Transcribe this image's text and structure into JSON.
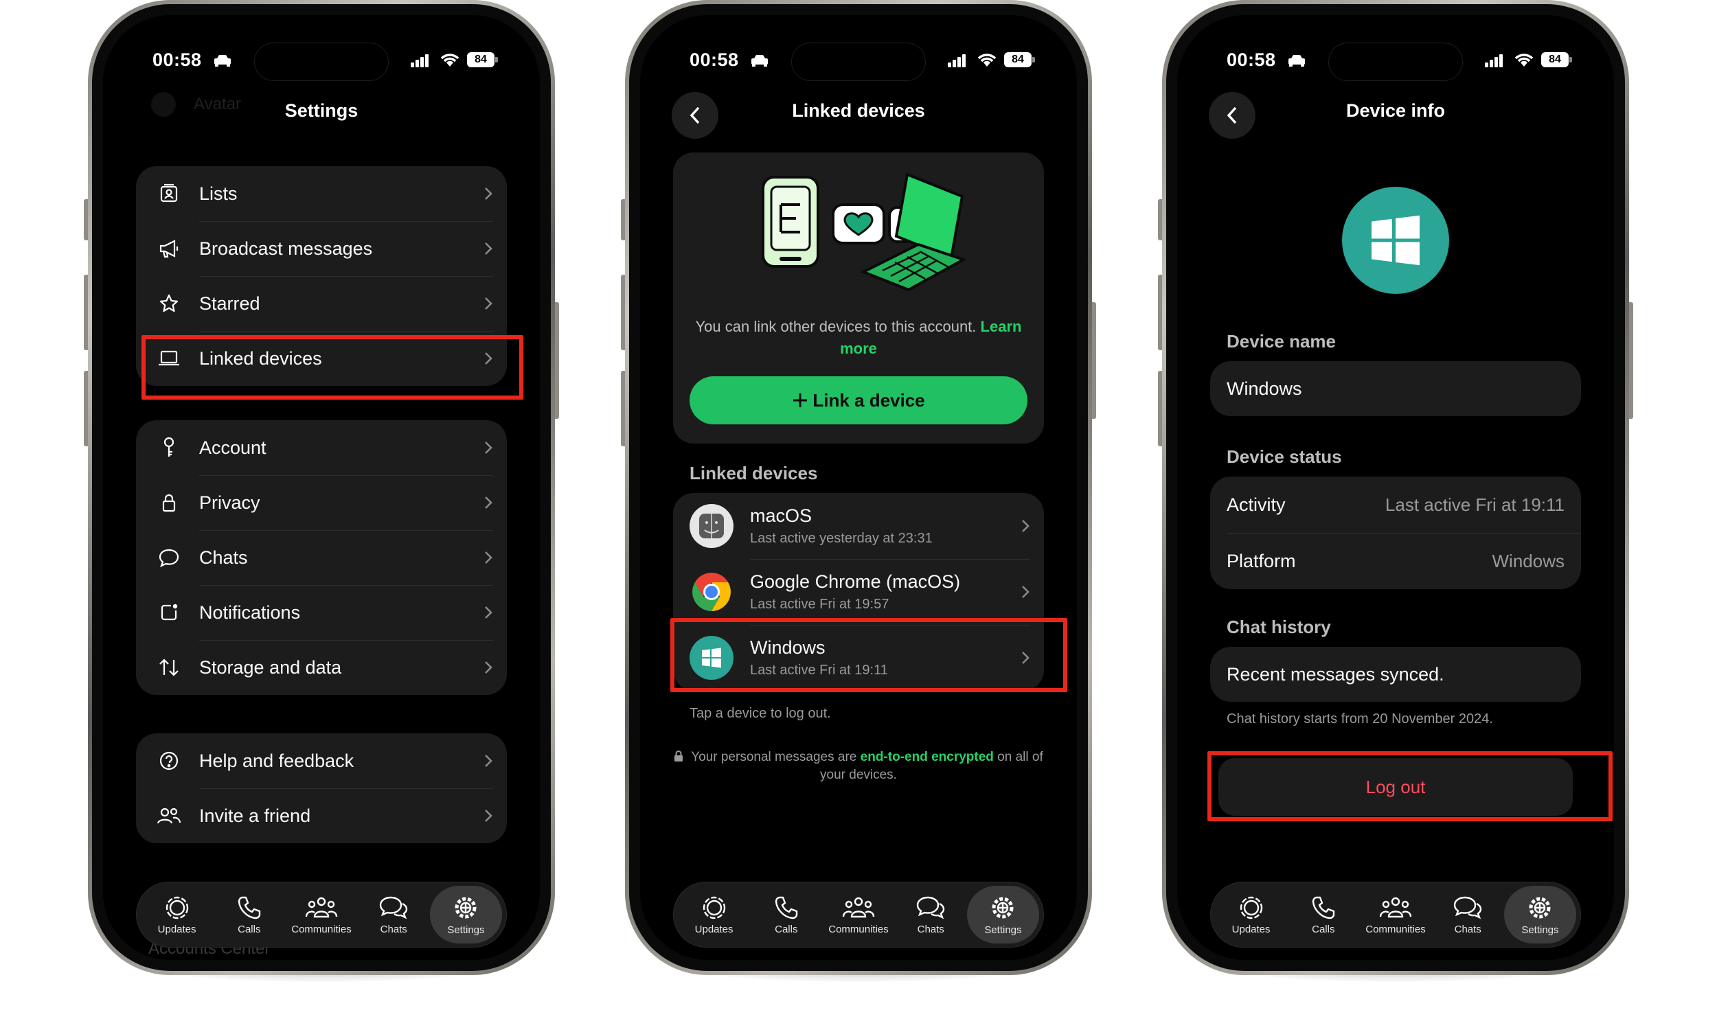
{
  "status": {
    "time": "00:58",
    "battery": "84"
  },
  "tabs": [
    {
      "label": "Updates"
    },
    {
      "label": "Calls"
    },
    {
      "label": "Communities"
    },
    {
      "label": "Chats"
    },
    {
      "label": "Settings"
    }
  ],
  "settings": {
    "title": "Settings",
    "ghost_top": "Avatar",
    "ghost_bottom": "Accounts Center",
    "group1": [
      "Lists",
      "Broadcast messages",
      "Starred",
      "Linked devices"
    ],
    "group2": [
      "Account",
      "Privacy",
      "Chats",
      "Notifications",
      "Storage and data"
    ],
    "group3": [
      "Help and feedback",
      "Invite a friend"
    ]
  },
  "linked": {
    "title": "Linked devices",
    "hero_text": "You can link other devices to this account.",
    "learn_more": "Learn more",
    "link_button": "Link a device",
    "section_label": "Linked devices",
    "devices": [
      {
        "name": "macOS",
        "sub": "Last active yesterday at 23:31"
      },
      {
        "name": "Google Chrome (macOS)",
        "sub": "Last active Fri at 19:57"
      },
      {
        "name": "Windows",
        "sub": "Last active Fri at 19:11"
      }
    ],
    "tap_note": "Tap a device to log out.",
    "enc_before": "Your personal messages are",
    "enc_link": "end-to-end encrypted",
    "enc_after": "on all of your devices."
  },
  "info": {
    "title": "Device info",
    "name_label": "Device name",
    "name_value": "Windows",
    "status_label": "Device status",
    "activity_key": "Activity",
    "activity_val": "Last active Fri at 19:11",
    "platform_key": "Platform",
    "platform_val": "Windows",
    "history_label": "Chat history",
    "history_value": "Recent messages synced.",
    "history_note": "Chat history starts from 20 November 2024.",
    "logout": "Log out"
  },
  "colors": {
    "accent_green": "#25d366",
    "highlight_red": "#e8261a",
    "logout_red": "#ff4d5e",
    "windows_teal": "#2aa596"
  }
}
